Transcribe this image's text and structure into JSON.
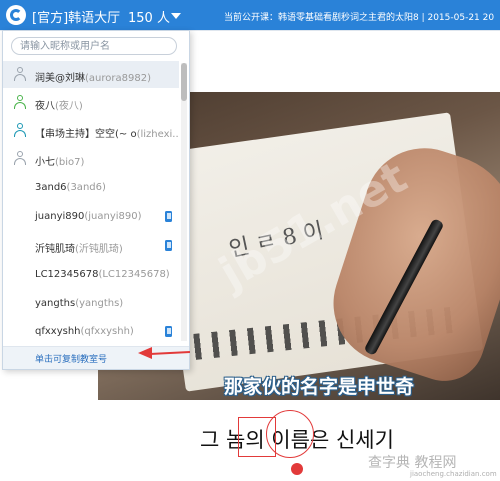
{
  "header": {
    "room_title": "[官方]韩语大厅",
    "online_count": "150 人",
    "now_playing": "当前公开课：韩语零基础看剧秒词之主君的太阳8 | 2015-05-21 20"
  },
  "dropdown": {
    "search_placeholder": "请输入昵称或用户名",
    "members": [
      {
        "name": "润美@刘琳",
        "username": "(aurora8982)",
        "avatar": "gray-avatar-icon",
        "selected": true
      },
      {
        "name": "夜八",
        "username": "(夜八)",
        "avatar": "green-avatar-icon"
      },
      {
        "name": "【串场主持】空空(~  o",
        "username": "(lizhexi...",
        "avatar": "teal-avatar-icon"
      },
      {
        "name": "小七",
        "username": "(bio7)",
        "avatar": "gray-avatar-icon"
      },
      {
        "name": "3and6",
        "username": "(3and6)"
      },
      {
        "name": "juanyi890",
        "username": "(juanyi890)",
        "mobile": true
      },
      {
        "name": "沂钝肌琦",
        "username": "(沂钝肌琦)",
        "mobile": true
      },
      {
        "name": "LC12345678",
        "username": "(LC12345678)"
      },
      {
        "name": "yangths",
        "username": "(yangths)"
      },
      {
        "name": "qfxxyshh",
        "username": "(qfxxyshh)",
        "mobile": true
      }
    ],
    "copy_link": "单击可复制教室号"
  },
  "video": {
    "subtitle_cn": "那家伙的名字是申世奇",
    "subtitle_kr": "그 놈의 이름은 신세기",
    "scribble": "인 ㄹ 8 이"
  },
  "watermarks": {
    "center": "jb51.net",
    "corner": "查字典 教程网",
    "corner_url": "jiaocheng.chazidian.com"
  },
  "colors": {
    "header_bg": "#2a82d8",
    "annotation_red": "#e23a3a",
    "link_blue": "#2a6fbe"
  }
}
